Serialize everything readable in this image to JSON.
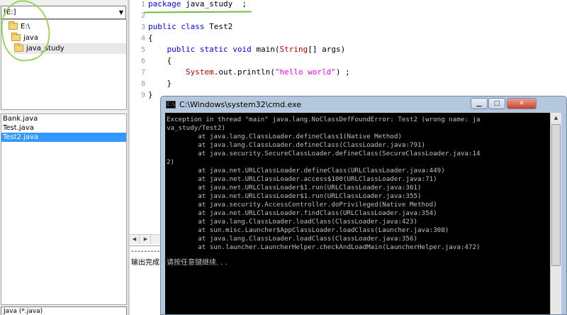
{
  "left_panel": {
    "drive_select": {
      "value": "[E:]",
      "arrow": "▼"
    },
    "folder_tree": [
      {
        "label": "E:\\",
        "icon": "folder-open-icon"
      },
      {
        "label": "java",
        "icon": "folder-open-icon"
      },
      {
        "label": "java_study",
        "icon": "folder-open-icon"
      }
    ],
    "files": [
      "Bank.java",
      "Test.java",
      "Test2.java"
    ],
    "selected_file": "Test2.java",
    "filter_select": {
      "value": "Java (*.java)"
    }
  },
  "editor": {
    "lines": [
      {
        "no": "1",
        "segments": [
          {
            "t": "package",
            "c": "kw"
          },
          {
            "t": " java_study  ;",
            "c": "plain"
          }
        ]
      },
      {
        "no": "2",
        "segments": []
      },
      {
        "no": "3",
        "segments": [
          {
            "t": "public",
            "c": "kw"
          },
          {
            "t": " ",
            "c": "plain"
          },
          {
            "t": "class",
            "c": "kw"
          },
          {
            "t": " Test2",
            "c": "plain"
          }
        ]
      },
      {
        "no": "4",
        "segments": [
          {
            "t": "{",
            "c": "plain"
          }
        ]
      },
      {
        "no": "5",
        "segments": [
          {
            "t": "    ",
            "c": "plain"
          },
          {
            "t": "public",
            "c": "kw"
          },
          {
            "t": " ",
            "c": "plain"
          },
          {
            "t": "static",
            "c": "kw"
          },
          {
            "t": " ",
            "c": "plain"
          },
          {
            "t": "void",
            "c": "kw"
          },
          {
            "t": " main(",
            "c": "plain"
          },
          {
            "t": "String",
            "c": "kw-red"
          },
          {
            "t": "[] args)",
            "c": "plain"
          }
        ]
      },
      {
        "no": "6",
        "segments": [
          {
            "t": "    {",
            "c": "plain"
          }
        ]
      },
      {
        "no": "7",
        "segments": [
          {
            "t": "        ",
            "c": "plain"
          },
          {
            "t": "System",
            "c": "sys"
          },
          {
            "t": ".out.println(",
            "c": "plain"
          },
          {
            "t": "\"hello world\"",
            "c": "str"
          },
          {
            "t": ") ;",
            "c": "plain"
          }
        ]
      },
      {
        "no": "8",
        "segments": [
          {
            "t": "    }",
            "c": "plain"
          }
        ]
      },
      {
        "no": "9",
        "segments": [
          {
            "t": "}",
            "c": "plain"
          }
        ]
      }
    ]
  },
  "output": {
    "dash_line": "-----------",
    "done_text": "输出完成"
  },
  "cmd": {
    "title": "C:\\Windows\\system32\\cmd.exe",
    "icon_text": "C:\\",
    "btn_min": "▁",
    "btn_max": "□",
    "btn_close": "✕",
    "console_lines": [
      "Exception in thread \"main\" java.lang.NoClassDefFoundError: Test2 (wrong name: ja",
      "va_study/Test2)",
      "        at java.lang.ClassLoader.defineClass1(Native Method)",
      "        at java.lang.ClassLoader.defineClass(ClassLoader.java:791)",
      "        at java.security.SecureClassLoader.defineClass(SecureClassLoader.java:14",
      "2)",
      "        at java.net.URLClassLoader.defineClass(URLClassLoader.java:449)",
      "        at java.net.URLClassLoader.access$100(URLClassLoader.java:71)",
      "        at java.net.URLClassLoader$1.run(URLClassLoader.java:361)",
      "        at java.net.URLClassLoader$1.run(URLClassLoader.java:355)",
      "        at java.security.AccessController.doPrivileged(Native Method)",
      "        at java.net.URLClassLoader.findClass(URLClassLoader.java:354)",
      "        at java.lang.ClassLoader.loadClass(ClassLoader.java:423)",
      "        at sun.misc.Launcher$AppClassLoader.loadClass(Launcher.java:308)",
      "        at java.lang.ClassLoader.loadClass(ClassLoader.java:356)",
      "        at sun.launcher.LauncherHelper.checkAndLoadMain(LauncherHelper.java:472)",
      "请按任意键继续. . ."
    ]
  }
}
